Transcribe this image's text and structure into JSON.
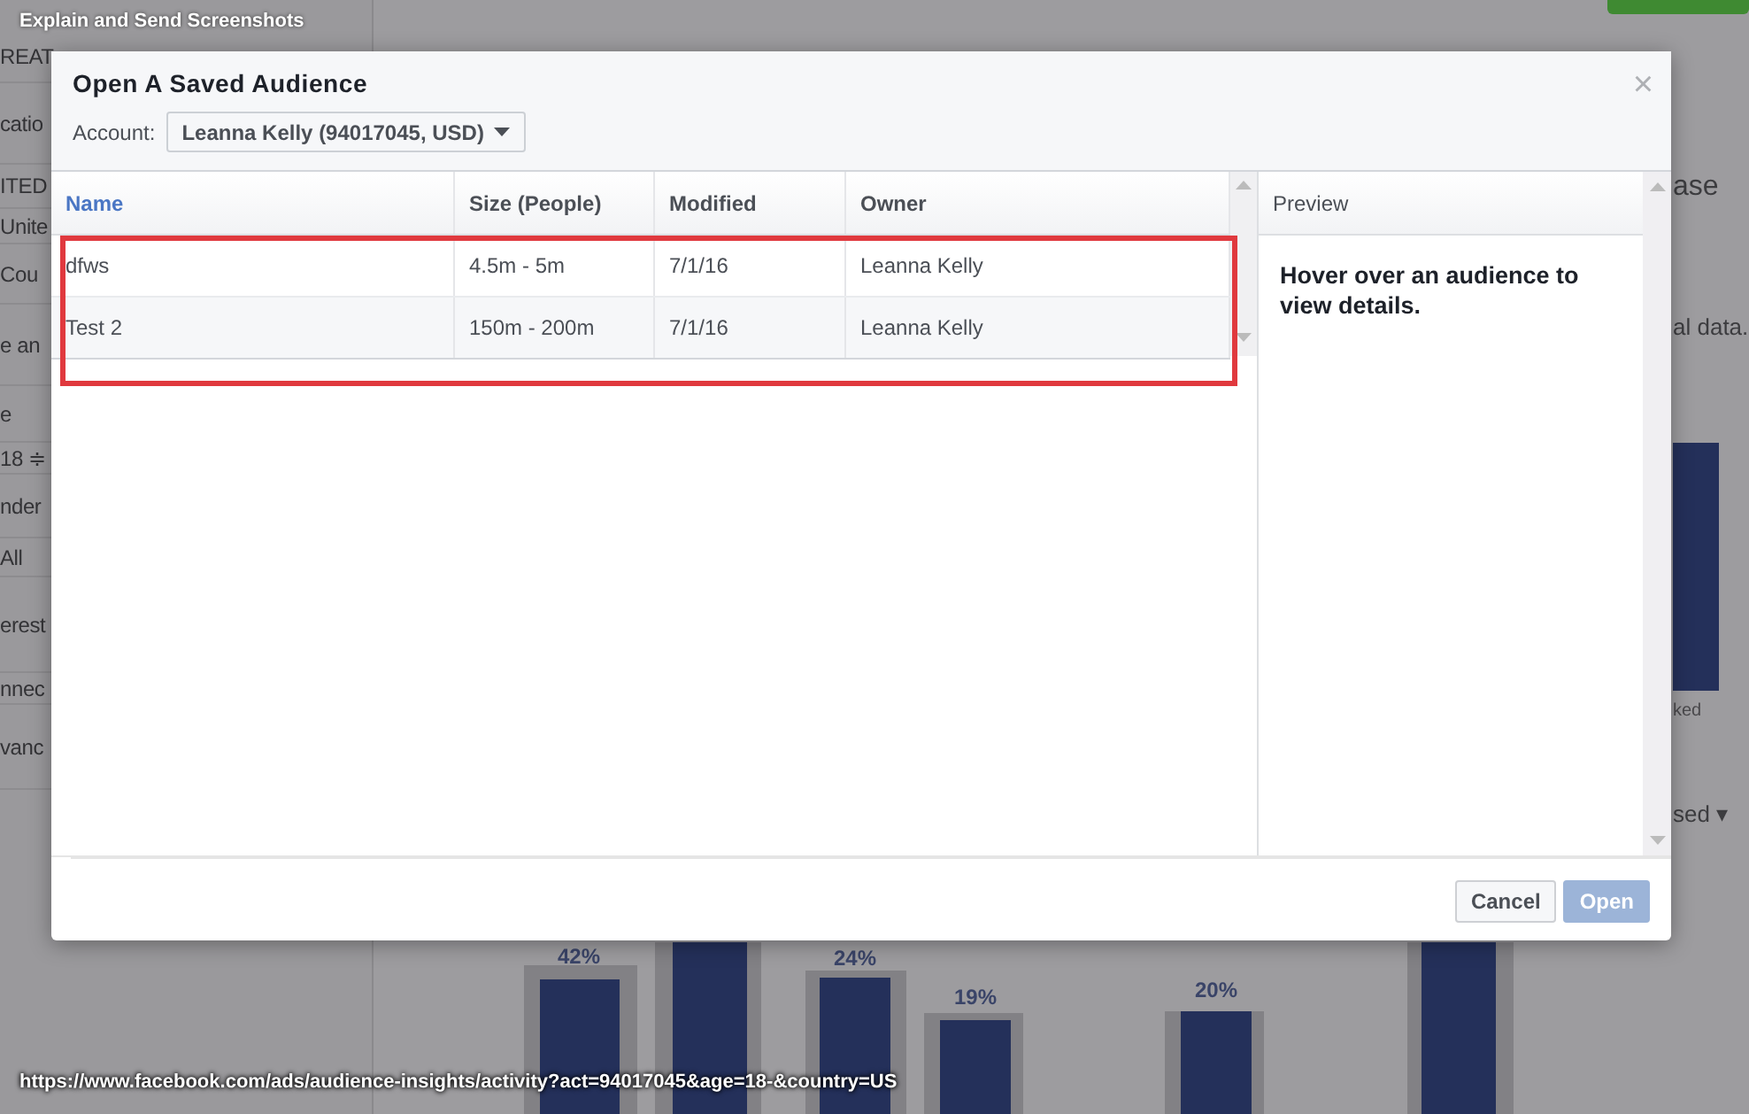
{
  "screenshot_tool": {
    "title": "Explain and Send Screenshots",
    "url": "https://www.facebook.com/ads/audience-insights/activity?act=94017045&age=18-&country=US"
  },
  "background_page": {
    "sidebar_items": [
      "REAT",
      "catio",
      "ITED",
      "Unite",
      "Cou",
      "e an",
      "e",
      "18 ≑",
      "nder",
      "All",
      "erest",
      "nnec",
      "vanc"
    ],
    "right_texts": [
      "ase",
      "al data.",
      "ked",
      "sed ▾"
    ],
    "bar_labels": [
      "42%",
      "24%",
      "19%",
      "20%"
    ]
  },
  "dialog": {
    "title": "Open A Saved Audience",
    "close": "×",
    "account_label": "Account:",
    "account_value": "Leanna Kelly (94017045, USD)",
    "columns": [
      {
        "label": "Name",
        "selected": true
      },
      {
        "label": "Size (People)",
        "selected": false
      },
      {
        "label": "Modified",
        "selected": false
      },
      {
        "label": "Owner",
        "selected": false
      }
    ],
    "rows": [
      [
        "dfws",
        "4.5m - 5m",
        "7/1/16",
        "Leanna Kelly"
      ],
      [
        "Test 2",
        "150m - 200m",
        "7/1/16",
        "Leanna Kelly"
      ]
    ],
    "preview": {
      "heading": "Preview",
      "text": "Hover over an audience to view details."
    },
    "buttons": [
      {
        "label": "Cancel",
        "disabled": false
      },
      {
        "label": "Open",
        "disabled": true
      }
    ]
  }
}
